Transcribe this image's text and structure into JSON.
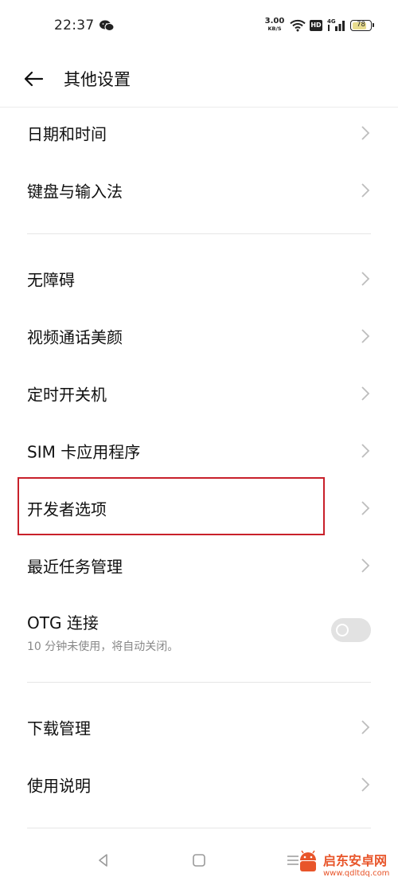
{
  "status_bar": {
    "time": "22:37",
    "net_speed_value": "3.00",
    "net_speed_unit": "KB/S",
    "hd_label": "HD",
    "battery": "78",
    "battery_level": 0.78
  },
  "header": {
    "title": "其他设置"
  },
  "items": [
    {
      "label": "日期和时间"
    },
    {
      "label": "键盘与输入法"
    },
    {
      "label": "无障碍"
    },
    {
      "label": "视频通话美颜"
    },
    {
      "label": "定时开关机"
    },
    {
      "label": "SIM 卡应用程序"
    },
    {
      "label": "开发者选项"
    },
    {
      "label": "最近任务管理"
    },
    {
      "label": "下载管理"
    },
    {
      "label": "使用说明"
    }
  ],
  "otg": {
    "title": "OTG 连接",
    "subtitle": "10 分钟未使用，将自动关闭。",
    "enabled": false
  },
  "watermark": {
    "name": "启东安卓网",
    "url": "www.qdltdq.com"
  },
  "colors": {
    "highlight": "#c8202a",
    "watermark": "#e8552a"
  }
}
